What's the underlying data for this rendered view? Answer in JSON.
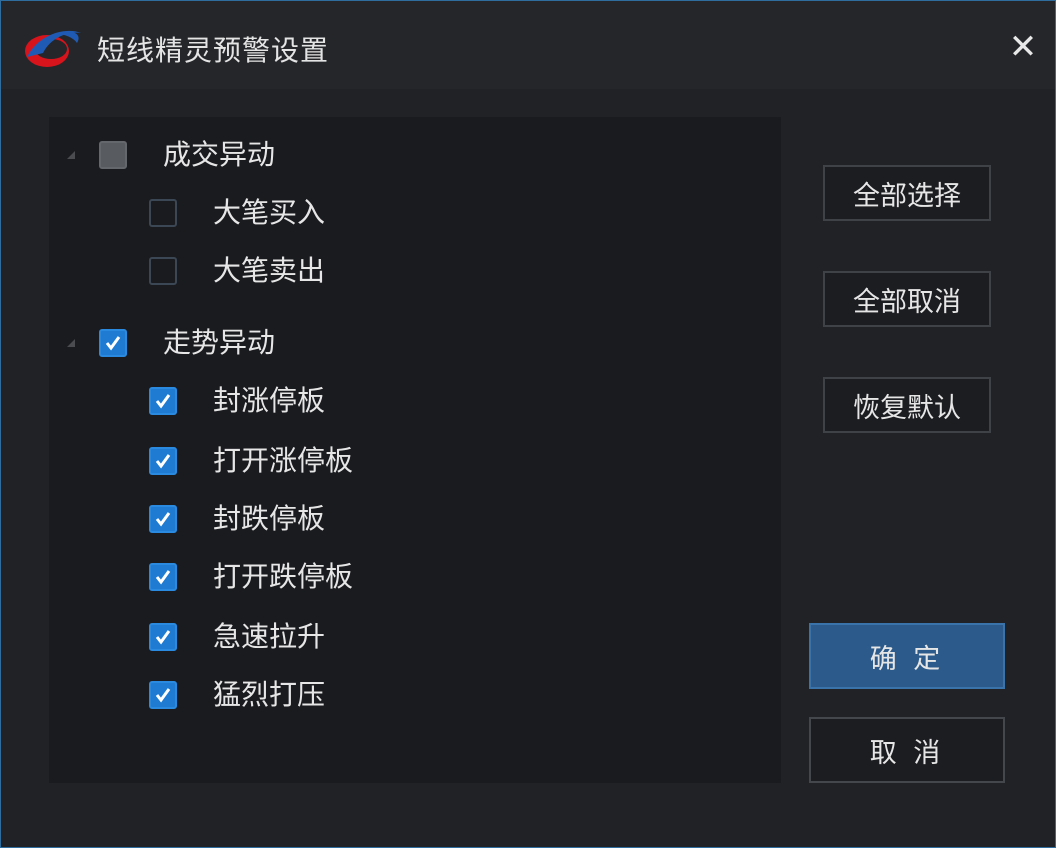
{
  "window": {
    "title": "短线精灵预警设置",
    "close_glyph": "✕",
    "logo": "app-logo-swoosh",
    "accent_color": "#1f7bd1"
  },
  "tree": {
    "groups": [
      {
        "label": "成交异动",
        "state": "partial",
        "expanded": true,
        "items": [
          {
            "label": "大笔买入",
            "checked": false
          },
          {
            "label": "大笔卖出",
            "checked": false
          }
        ]
      },
      {
        "label": "走势异动",
        "state": "checked",
        "expanded": true,
        "items": [
          {
            "label": "封涨停板",
            "checked": true
          },
          {
            "label": "打开涨停板",
            "checked": true
          },
          {
            "label": "封跌停板",
            "checked": true
          },
          {
            "label": "打开跌停板",
            "checked": true
          },
          {
            "label": "急速拉升",
            "checked": true
          },
          {
            "label": "猛烈打压",
            "checked": true
          }
        ]
      }
    ]
  },
  "actions": {
    "select_all": "全部选择",
    "deselect_all": "全部取消",
    "restore_default": "恢复默认",
    "ok": "确 定",
    "cancel": "取 消"
  }
}
